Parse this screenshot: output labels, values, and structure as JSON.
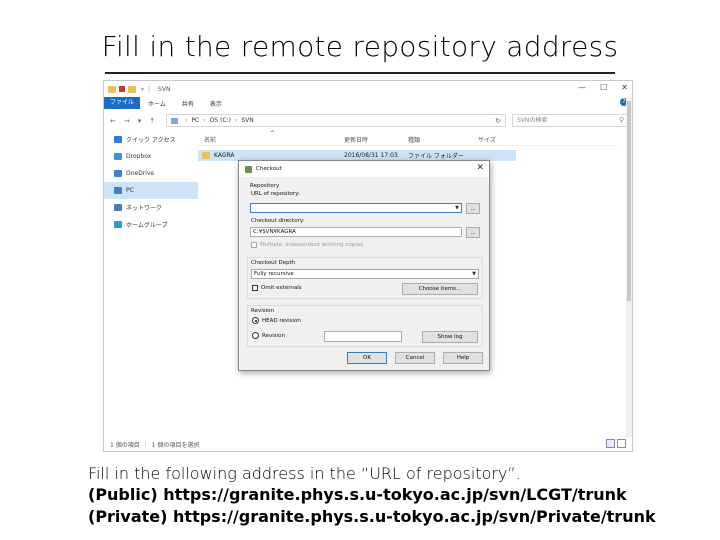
{
  "slide": {
    "title": "Fill in the remote repository address",
    "caption": {
      "line1": "Fill in the following address in the “URL of repository”.",
      "line2": "(Public) https://granite.phys.s.u-tokyo.ac.jp/svn/LCGT/trunk",
      "line3": "(Private) https://granite.phys.s.u-tokyo.ac.jp/svn/Private/trunk"
    }
  },
  "explorer": {
    "window_title": "SVN",
    "ribbon_tabs": [
      "ファイル",
      "ホーム",
      "共有",
      "表示"
    ],
    "address_crumbs": [
      "PC",
      "OS (C:)",
      "SVN"
    ],
    "search_placeholder": "SVNの検索",
    "nav_items": [
      {
        "label": "クイック アクセス",
        "icon": "star-icon",
        "color": "#2d7dd2"
      },
      {
        "label": "Dropbox",
        "icon": "dropbox-icon",
        "color": "#3d8fe0"
      },
      {
        "label": "OneDrive",
        "icon": "cloud-icon",
        "color": "#3b82d6"
      },
      {
        "label": "PC",
        "icon": "computer-icon",
        "color": "#4a7fb5"
      },
      {
        "label": "ネットワーク",
        "icon": "network-icon",
        "color": "#4a7fb5"
      },
      {
        "label": "ホームグループ",
        "icon": "homegroup-icon",
        "color": "#2f9ad0"
      }
    ],
    "columns": {
      "name": "名前",
      "date": "更新日時",
      "type": "種類",
      "size": "サイズ"
    },
    "files": [
      {
        "name": "KAGRA",
        "date": "2016/08/31 17:03",
        "type": "ファイル フォルダー",
        "size": ""
      }
    ],
    "status": {
      "count": "1 個の項目",
      "selected": "1 個の項目を選択"
    }
  },
  "checkout": {
    "title": "Checkout",
    "repository_group": "Repository",
    "url_label": "URL of repository:",
    "url_value": "",
    "browse_label": "...",
    "checkout_dir_label": "Checkout directory:",
    "checkout_dir_value": "C:¥SVN¥KAGRA",
    "multiple_label": "Multiple, independent working copies",
    "depth_group": "Checkout Depth",
    "depth_value": "Fully recursive",
    "omit_externals": "Omit externals",
    "choose_items": "Choose items...",
    "revision_group": "Revision",
    "head_revision": "HEAD revision",
    "revision_label": "Revision",
    "revision_value": "",
    "show_log": "Show log",
    "ok": "OK",
    "cancel": "Cancel",
    "help": "Help"
  }
}
